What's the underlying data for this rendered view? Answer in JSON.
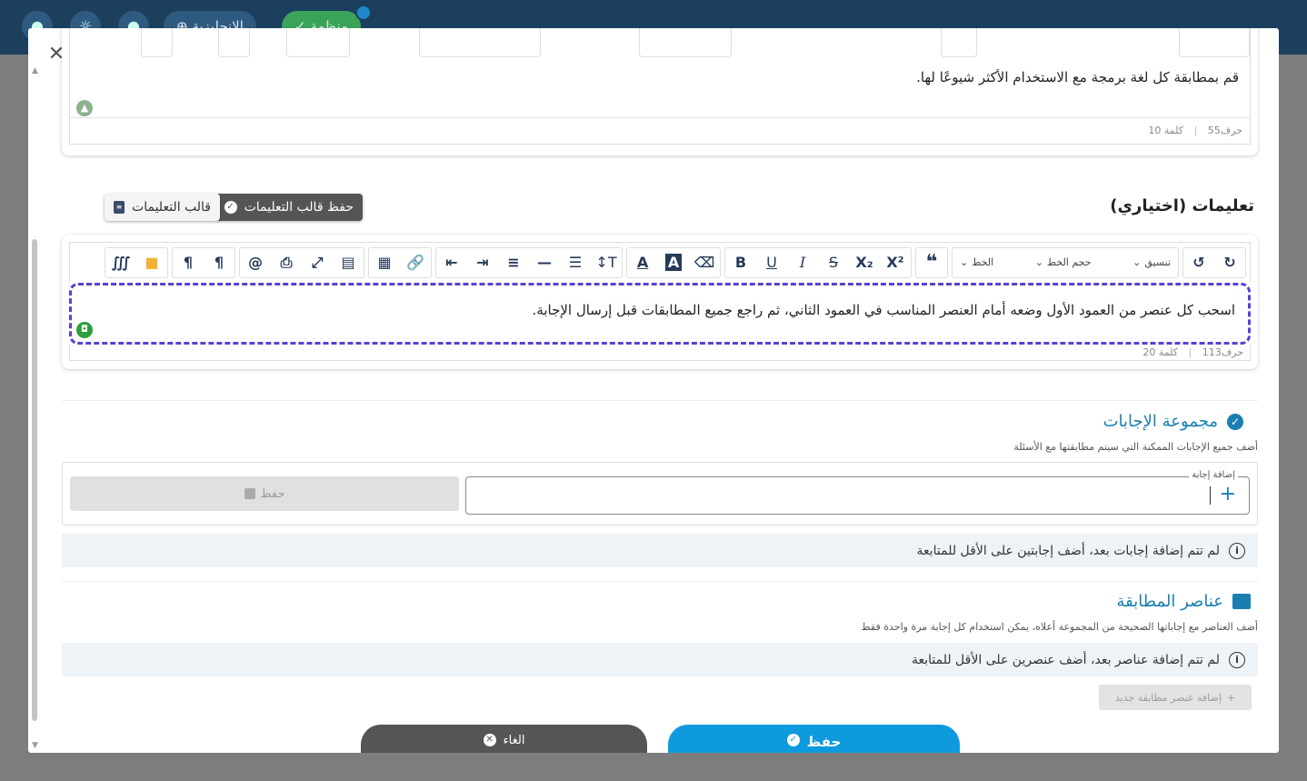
{
  "background": {
    "language_pill": "الإنجليزية",
    "status_pill": "منظمة"
  },
  "top_editor": {
    "text": "قم بمطابقة كل لغة برمجة مع الاستخدام الأكثر شيوعًا لها.",
    "chars": "حرف55",
    "words": "كلمة 10"
  },
  "instructions": {
    "title": "تعليمات (اختياري)",
    "save_template_label": "حفظ قالب التعليمات",
    "template_label": "قالب التعليمات",
    "toolbar": {
      "style_select": "تنسيق",
      "size_select": "حجم الخط",
      "font_select": "الخط"
    },
    "text": "اسحب كل عنصر من العمود الأول وضعه أمام العنصر المناسب في العمود الثاني، ثم راجع جميع المطابقات قبل إرسال الإجابة.",
    "chars": "حرف113",
    "words": "كلمة 20"
  },
  "answers": {
    "title": "مجموعة الإجابات",
    "subtitle": "أضف جميع الإجابات الممكنة التي سيتم مطابقتها مع الأسئلة",
    "input_label": "إضافة إجابة",
    "input_value": "",
    "save_label": "حفظ",
    "empty_notice": "لم تتم إضافة إجابات بعد، أضف إجابتين على الأقل للمتابعة"
  },
  "matching": {
    "title": "عناصر المطابقة",
    "subtitle": "أضف العناصر مع إجاباتها الصحيحة من المجموعة أعلاه، يمكن استخدام كل إجابة مرة واحدة فقط",
    "empty_notice": "لم تتم إضافة عناصر بعد، أضف عنصرين على الأقل للمتابعة",
    "add_label": "إضافة عنصر مطابقة جديد"
  },
  "footer": {
    "save_label": "حفظ",
    "cancel_label": "الغاء"
  },
  "colors": {
    "accent": "#1a7fb0",
    "primary_button": "#0f9ade",
    "dark_button": "#555555",
    "focus_border": "#5b3fd1"
  }
}
